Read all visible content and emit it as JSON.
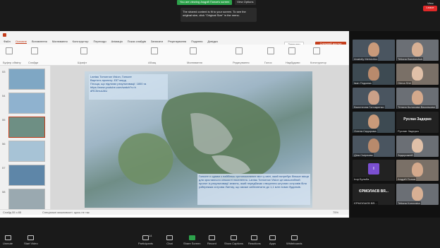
{
  "top": {
    "share_text": "You are viewing Андрій Попов's screen",
    "view_options": "View Options",
    "view_label": "View",
    "tooltip": "The shared content is fit to your screen. To see the original size, click \"Original Size\" in the menu."
  },
  "ppt": {
    "tabs": [
      "Файл",
      "Основне",
      "Вставлення",
      "Малювання",
      "Конструктор",
      "Переходи",
      "Анімація",
      "Показ слайдів",
      "Записати",
      "Рецензування",
      "Подання",
      "Довідка"
    ],
    "write_label": "Записати",
    "share_label": "Спільний доступ",
    "ribbon_groups": [
      "Буфер обміну",
      "Слайди",
      "Шрифт",
      "Абзац",
      "Малювання",
      "Редагування",
      "Голос",
      "Надбудови",
      "Конструктор"
    ],
    "thumb_numbers": [
      "53",
      "54",
      "55",
      "56",
      "57",
      "58"
    ],
    "slide_text1": "Lantau Tomorrow Vision, Гонконг\nВартість проекту: £57 млрд\nПлоща, що підлягає рекультивації: 1800 га\nhttps://www.youtube.com/watch?v=h\ndRC5muUAU",
    "slide_text2": "Гонконг є одним з найбільш густонаселених міст у світі, який потребує більше місця для зростаючого кількості населення. Lantau Tomorrow Vision це масштабний проект із рекультивації земель, який передбачає створення штучних островів біля узбережжя острова Лантау, що зможе забезпечити до 1,1 млн нових будинків.",
    "status_slide": "Слайд 55 з 85",
    "status_access": "Спеціальні можливості: щось не так",
    "status_zoom": "75%"
  },
  "participants": [
    {
      "name": "Anatoliy Melnichko",
      "type": "video"
    },
    {
      "name": "Tetiana Bandarchuk",
      "type": "video"
    },
    {
      "name": "Іван Подоєва",
      "type": "video"
    },
    {
      "name": "Olena Shit",
      "type": "video"
    },
    {
      "name": "Валентина Гончаренко",
      "type": "video"
    },
    {
      "name": "Тетяна Колосова Васильова",
      "type": "video"
    },
    {
      "name": "Олена Сидорова",
      "type": "video"
    },
    {
      "name": "Руслан Задерко",
      "type": "text"
    },
    {
      "name": "Діна Смірнова",
      "type": "video"
    },
    {
      "name": "Задорожній",
      "type": "video"
    },
    {
      "name": "Ігор Бульба",
      "type": "avatar",
      "initial": "I"
    },
    {
      "name": "Андрій Попов",
      "type": "video"
    },
    {
      "name": "ЄРМОЛАЄВ ВЯ...",
      "type": "text"
    },
    {
      "name": "Tetiana Konovska",
      "type": "video"
    }
  ],
  "bottom": {
    "items": [
      "Unmute",
      "Start Video",
      "Participants",
      "Chat",
      "Share Screen",
      "Record",
      "Show Captions",
      "Reactions",
      "Apps",
      "Whiteboards"
    ],
    "participants_count": "14",
    "end": "Leave"
  }
}
